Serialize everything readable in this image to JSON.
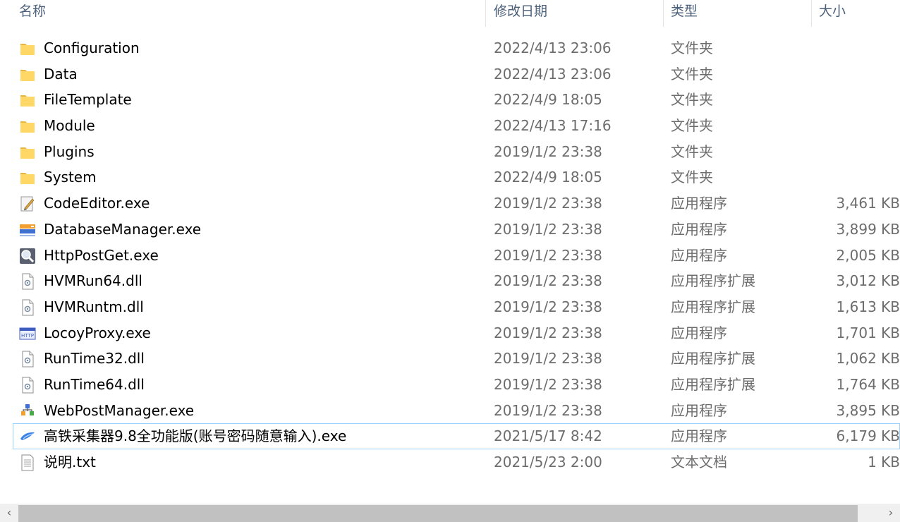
{
  "columns": {
    "name": "名称",
    "date": "修改日期",
    "type": "类型",
    "size": "大小"
  },
  "files": [
    {
      "icon": "folder-icon",
      "name": "Configuration",
      "date": "2022/4/13 23:06",
      "type": "文件夹",
      "size": ""
    },
    {
      "icon": "folder-icon",
      "name": "Data",
      "date": "2022/4/13 23:06",
      "type": "文件夹",
      "size": ""
    },
    {
      "icon": "folder-icon",
      "name": "FileTemplate",
      "date": "2022/4/9 18:05",
      "type": "文件夹",
      "size": ""
    },
    {
      "icon": "folder-icon",
      "name": "Module",
      "date": "2022/4/13 17:16",
      "type": "文件夹",
      "size": ""
    },
    {
      "icon": "folder-icon",
      "name": "Plugins",
      "date": "2019/1/2 23:38",
      "type": "文件夹",
      "size": ""
    },
    {
      "icon": "folder-icon",
      "name": "System",
      "date": "2022/4/9 18:05",
      "type": "文件夹",
      "size": ""
    },
    {
      "icon": "code-editor-icon",
      "name": "CodeEditor.exe",
      "date": "2019/1/2 23:38",
      "type": "应用程序",
      "size": "3,461 KB"
    },
    {
      "icon": "database-manager-icon",
      "name": "DatabaseManager.exe",
      "date": "2019/1/2 23:38",
      "type": "应用程序",
      "size": "3,899 KB"
    },
    {
      "icon": "magnifier-app-icon",
      "name": "HttpPostGet.exe",
      "date": "2019/1/2 23:38",
      "type": "应用程序",
      "size": "2,005 KB"
    },
    {
      "icon": "dll-file-icon",
      "name": "HVMRun64.dll",
      "date": "2019/1/2 23:38",
      "type": "应用程序扩展",
      "size": "3,012 KB"
    },
    {
      "icon": "dll-file-icon",
      "name": "HVMRuntm.dll",
      "date": "2019/1/2 23:38",
      "type": "应用程序扩展",
      "size": "1,613 KB"
    },
    {
      "icon": "http-proxy-icon",
      "name": "LocoyProxy.exe",
      "date": "2019/1/2 23:38",
      "type": "应用程序",
      "size": "1,701 KB"
    },
    {
      "icon": "dll-file-icon",
      "name": "RunTime32.dll",
      "date": "2019/1/2 23:38",
      "type": "应用程序扩展",
      "size": "1,062 KB"
    },
    {
      "icon": "dll-file-icon",
      "name": "RunTime64.dll",
      "date": "2019/1/2 23:38",
      "type": "应用程序扩展",
      "size": "1,764 KB"
    },
    {
      "icon": "web-post-icon",
      "name": "WebPostManager.exe",
      "date": "2019/1/2 23:38",
      "type": "应用程序",
      "size": "3,895 KB"
    },
    {
      "icon": "crawler-app-icon",
      "name": "高铁采集器9.8全功能版(账号密码随意输入).exe",
      "date": "2021/5/17 8:42",
      "type": "应用程序",
      "size": "6,179 KB",
      "selected": true
    },
    {
      "icon": "text-file-icon",
      "name": "说明.txt",
      "date": "2021/5/23 2:00",
      "type": "文本文档",
      "size": "1 KB"
    }
  ],
  "scrollbar": {
    "left_arrow": "‹",
    "right_arrow": "›"
  },
  "colors": {
    "folder": "#ffd766",
    "selection_border": "#99d1ff",
    "header_text": "#4c607a",
    "meta_text": "#6d6d6d"
  }
}
